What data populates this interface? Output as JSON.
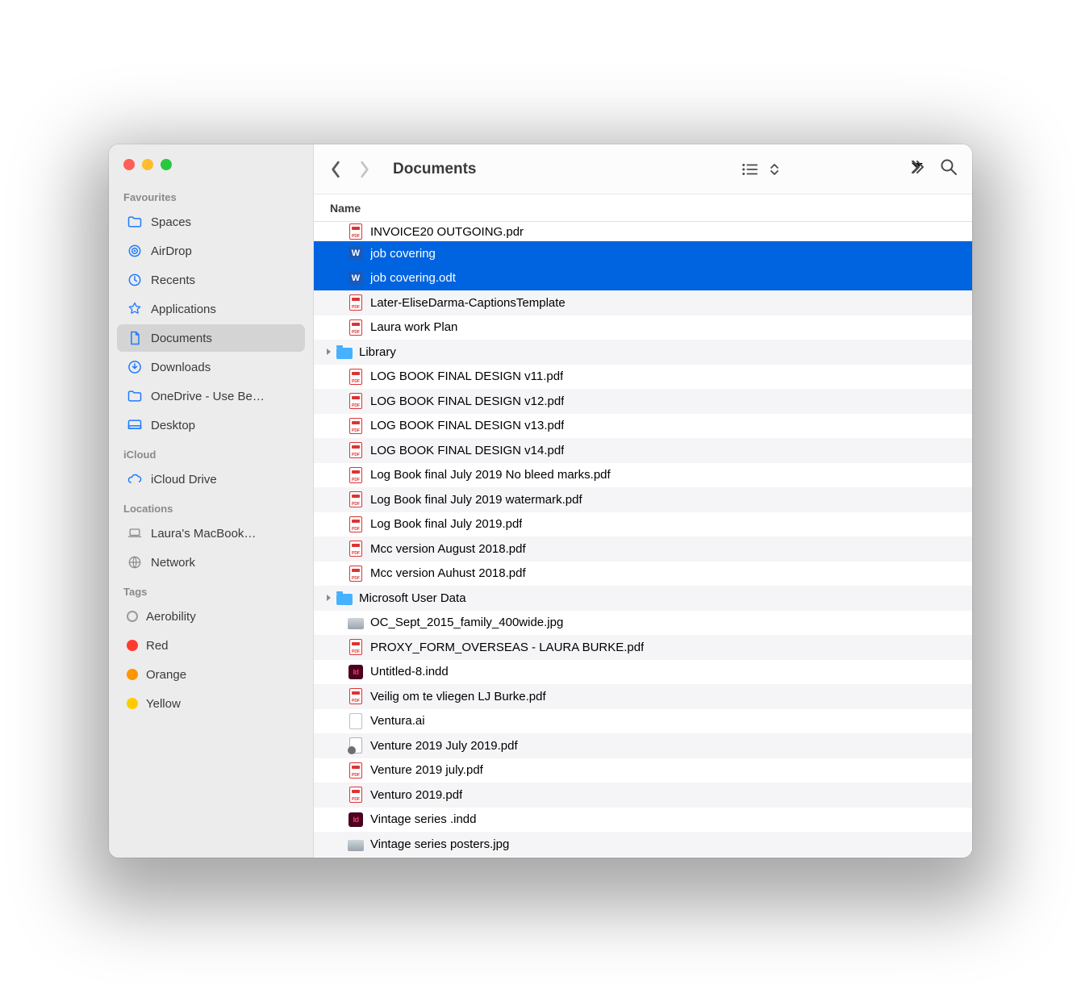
{
  "window": {
    "title": "Documents"
  },
  "list_header": {
    "name_label": "Name"
  },
  "sidebar": {
    "sections": {
      "favourites": {
        "label": "Favourites"
      },
      "icloud": {
        "label": "iCloud"
      },
      "locations": {
        "label": "Locations"
      },
      "tags": {
        "label": "Tags"
      }
    },
    "favourites": [
      {
        "label": "Spaces",
        "icon": "folder"
      },
      {
        "label": "AirDrop",
        "icon": "airdrop"
      },
      {
        "label": "Recents",
        "icon": "clock"
      },
      {
        "label": "Applications",
        "icon": "apps"
      },
      {
        "label": "Documents",
        "icon": "doc",
        "selected": true
      },
      {
        "label": "Downloads",
        "icon": "download"
      },
      {
        "label": "OneDrive - Use Be…",
        "icon": "folder"
      },
      {
        "label": "Desktop",
        "icon": "desktop"
      }
    ],
    "icloud": [
      {
        "label": "iCloud Drive",
        "icon": "cloud"
      }
    ],
    "locations": [
      {
        "label": "Laura's MacBook…",
        "icon": "laptop"
      },
      {
        "label": "Network",
        "icon": "globe"
      }
    ],
    "tags": [
      {
        "label": "Aerobility",
        "color": "outline"
      },
      {
        "label": "Red",
        "color": "red"
      },
      {
        "label": "Orange",
        "color": "orange"
      },
      {
        "label": "Yellow",
        "color": "yellow"
      }
    ]
  },
  "files": [
    {
      "name": "INVOICE20 OUTGOING.pdr",
      "icon": "pdf",
      "cut": true
    },
    {
      "name": "job covering",
      "icon": "word",
      "selected": true
    },
    {
      "name": "job covering.odt",
      "icon": "word",
      "selected": true
    },
    {
      "name": "Later-EliseDarma-CaptionsTemplate",
      "icon": "pdf"
    },
    {
      "name": "Laura work Plan",
      "icon": "pdf"
    },
    {
      "name": "Library",
      "icon": "folder",
      "expandable": true
    },
    {
      "name": "LOG BOOK FINAL DESIGN v11.pdf",
      "icon": "pdf"
    },
    {
      "name": "LOG BOOK FINAL DESIGN v12.pdf",
      "icon": "pdf"
    },
    {
      "name": "LOG BOOK FINAL DESIGN v13.pdf",
      "icon": "pdf"
    },
    {
      "name": "LOG BOOK FINAL DESIGN v14.pdf",
      "icon": "pdf"
    },
    {
      "name": "Log Book final July 2019 No bleed marks.pdf",
      "icon": "pdf"
    },
    {
      "name": "Log Book final July 2019 watermark.pdf",
      "icon": "pdf"
    },
    {
      "name": "Log Book final July 2019.pdf",
      "icon": "pdf"
    },
    {
      "name": "Mcc version August 2018.pdf",
      "icon": "pdf"
    },
    {
      "name": "Mcc version Auhust 2018.pdf",
      "icon": "pdf"
    },
    {
      "name": "Microsoft User Data",
      "icon": "folder",
      "expandable": true
    },
    {
      "name": "OC_Sept_2015_family_400wide.jpg",
      "icon": "img"
    },
    {
      "name": "PROXY_FORM_OVERSEAS - LAURA BURKE.pdf",
      "icon": "pdf"
    },
    {
      "name": "Untitled-8.indd",
      "icon": "indd"
    },
    {
      "name": "Veilig om te vliegen LJ Burke.pdf",
      "icon": "pdf"
    },
    {
      "name": "Ventura.ai",
      "icon": "generic"
    },
    {
      "name": "Venture 2019 July 2019.pdf",
      "icon": "locked"
    },
    {
      "name": "Venture 2019 july.pdf",
      "icon": "pdf"
    },
    {
      "name": "Venturo 2019.pdf",
      "icon": "pdf"
    },
    {
      "name": "Vintage series .indd",
      "icon": "indd"
    },
    {
      "name": "Vintage series posters.jpg",
      "icon": "img"
    }
  ]
}
